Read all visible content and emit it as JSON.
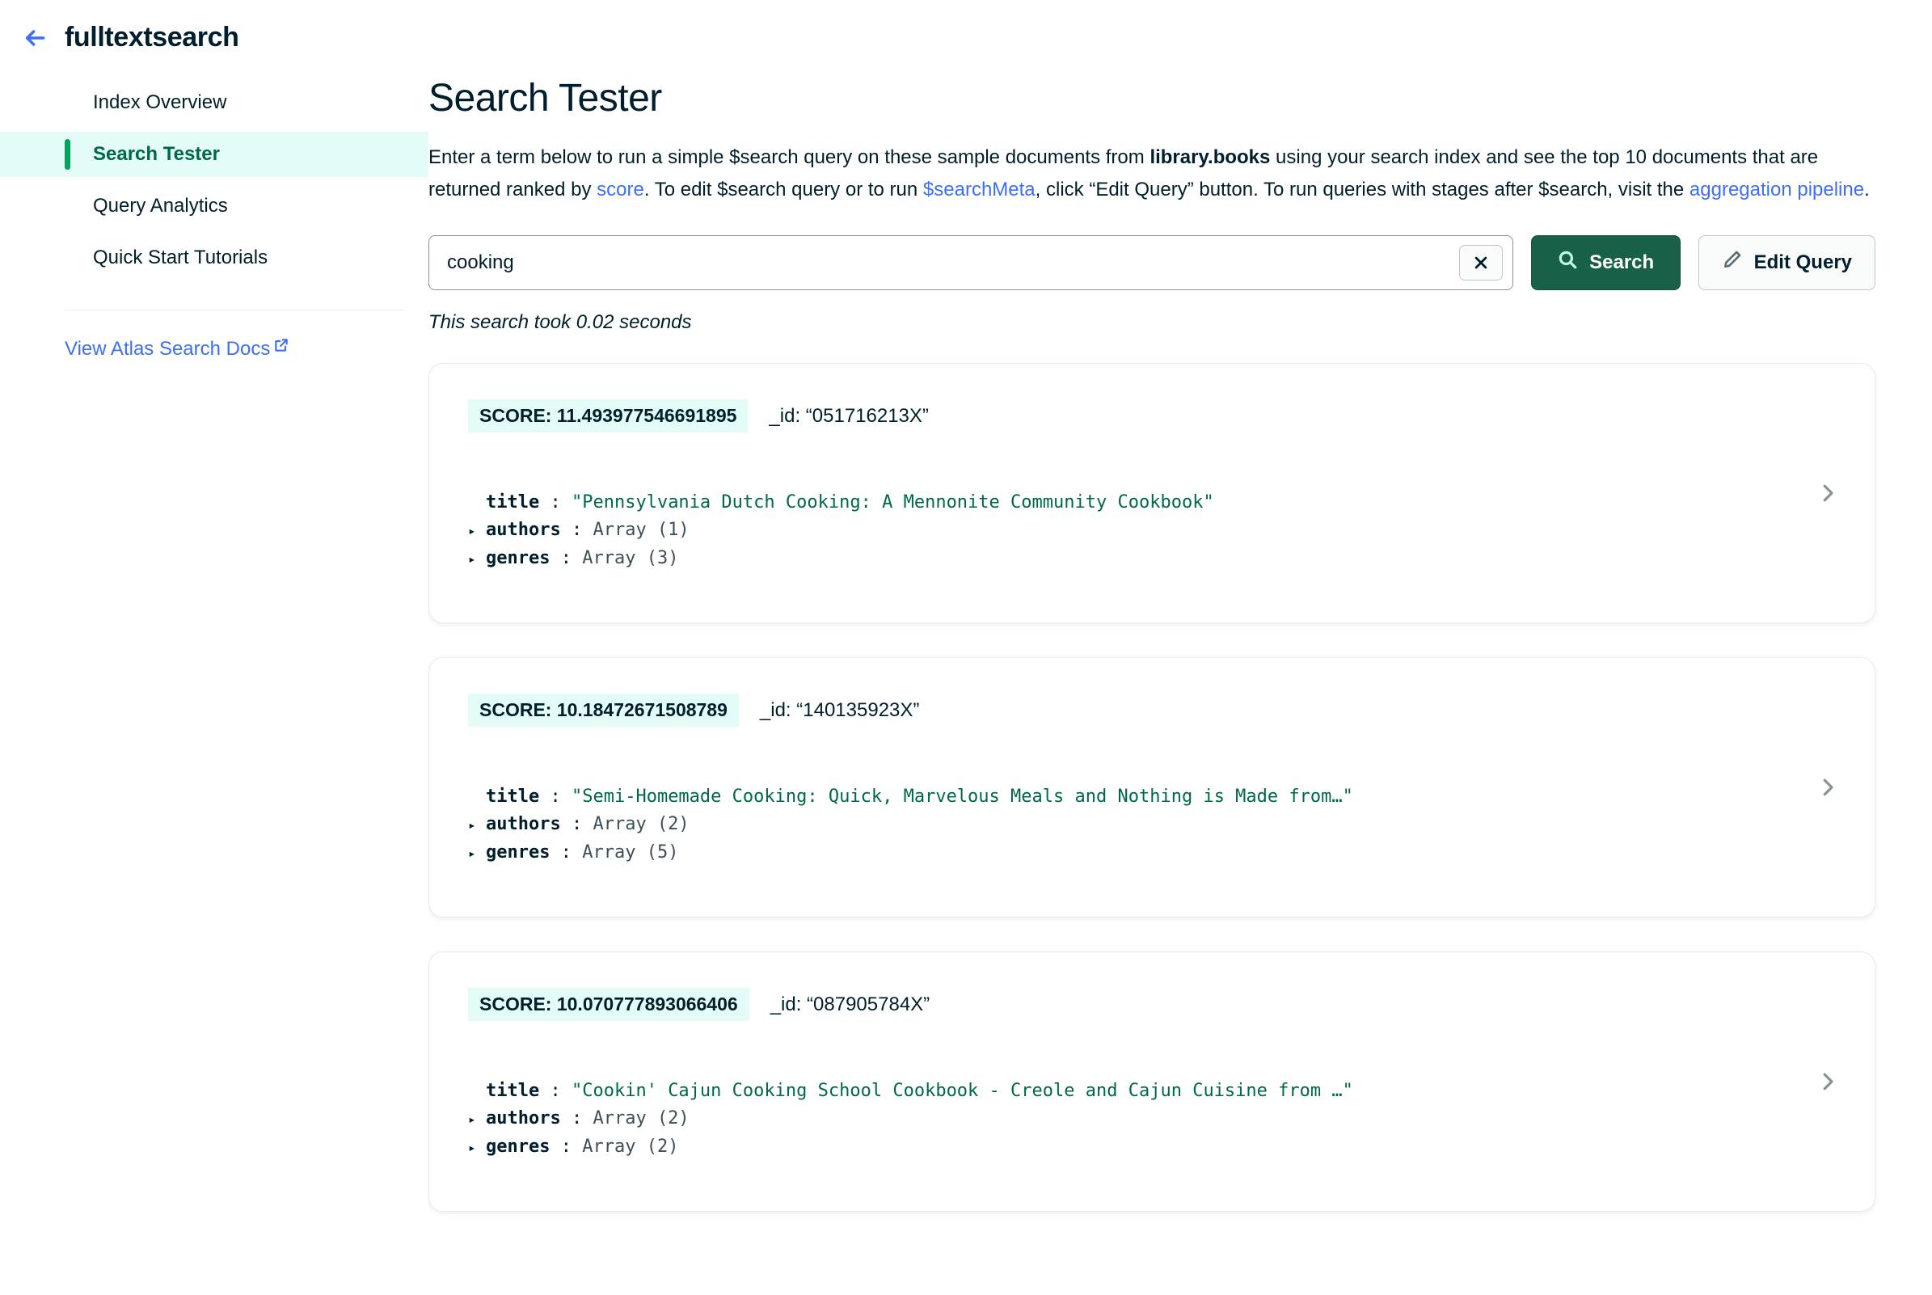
{
  "sidebar": {
    "back_icon": "arrow-left-icon",
    "title": "fulltextsearch",
    "items": [
      {
        "label": "Index Overview",
        "active": false
      },
      {
        "label": "Search Tester",
        "active": true
      },
      {
        "label": "Query Analytics",
        "active": false
      },
      {
        "label": "Quick Start Tutorials",
        "active": false
      }
    ],
    "docs_link": {
      "label": "View Atlas Search Docs",
      "icon": "external-link-icon"
    }
  },
  "main": {
    "page_title": "Search Tester",
    "description": {
      "part1": "Enter a term below to run a simple $search query on these sample documents from ",
      "bold1": "library.books",
      "part2": " using your search index and see the top 10 documents that are returned ranked by ",
      "link1": "score",
      "part3": ". To edit $search query or to run ",
      "link2": "$searchMeta",
      "part4": ", click “Edit Query” button. To run queries with stages after $search, visit the ",
      "link3": "aggregation pipeline",
      "part5": "."
    },
    "search": {
      "value": "cooking",
      "placeholder": "",
      "clear_label": "✖",
      "clear_icon": "close-icon",
      "search_button": {
        "label": "Search",
        "icon": "search-icon"
      },
      "edit_query_button": {
        "label": "Edit Query",
        "icon": "pencil-icon"
      }
    },
    "search_time": "This search took 0.02 seconds",
    "results": [
      {
        "score_label": "SCORE: 11.493977546691895",
        "id_label": "_id: “051716213X”",
        "fields": [
          {
            "expandable": false,
            "key": "title",
            "value": "\"Pennsylvania Dutch Cooking: A Mennonite Community Cookbook\"",
            "type": "string"
          },
          {
            "expandable": true,
            "key": "authors",
            "value": "Array (1)",
            "type": "array"
          },
          {
            "expandable": true,
            "key": "genres",
            "value": "Array (3)",
            "type": "array"
          }
        ],
        "chevron_icon": "chevron-right-icon"
      },
      {
        "score_label": "SCORE: 10.18472671508789",
        "id_label": "_id: “140135923X”",
        "fields": [
          {
            "expandable": false,
            "key": "title",
            "value": "\"Semi-Homemade Cooking: Quick, Marvelous Meals and Nothing is Made from…\"",
            "type": "string"
          },
          {
            "expandable": true,
            "key": "authors",
            "value": "Array (2)",
            "type": "array"
          },
          {
            "expandable": true,
            "key": "genres",
            "value": "Array (5)",
            "type": "array"
          }
        ],
        "chevron_icon": "chevron-right-icon"
      },
      {
        "score_label": "SCORE: 10.070777893066406",
        "id_label": "_id: “087905784X”",
        "fields": [
          {
            "expandable": false,
            "key": "title",
            "value": "\"Cookin' Cajun Cooking School Cookbook - Creole and Cajun Cuisine from …\"",
            "type": "string"
          },
          {
            "expandable": true,
            "key": "authors",
            "value": "Array (2)",
            "type": "array"
          },
          {
            "expandable": true,
            "key": "genres",
            "value": "Array (2)",
            "type": "array"
          }
        ],
        "chevron_icon": "chevron-right-icon"
      }
    ]
  },
  "colors": {
    "brand_green": "#00684A",
    "accent_green": "#00A35C",
    "button_green": "#186048",
    "badge_bg": "#E3FCF7",
    "link_blue": "#3D6FF5",
    "text_dark": "#001E2B",
    "string_green": "#00684A",
    "border_gray": "#E8EDEB"
  }
}
